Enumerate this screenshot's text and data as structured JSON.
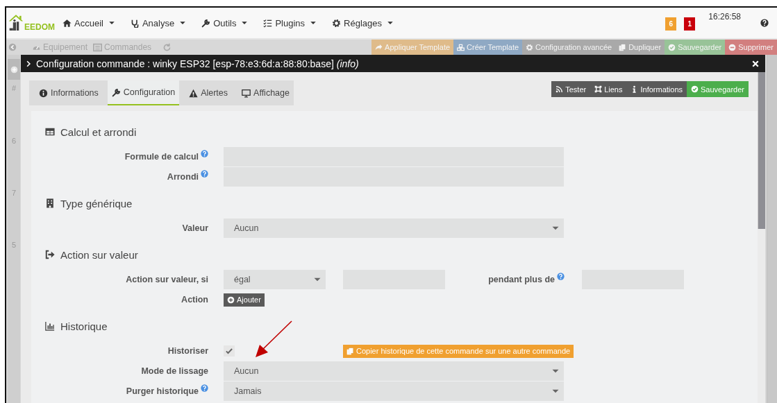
{
  "nav": {
    "logo": "EEDOM",
    "menus": [
      {
        "label": "Accueil"
      },
      {
        "label": "Analyse"
      },
      {
        "label": "Outils"
      },
      {
        "label": "Plugins"
      },
      {
        "label": "Réglages"
      }
    ],
    "badges": [
      {
        "text": "6",
        "color": "#f0a030"
      },
      {
        "text": "1",
        "color": "#c9000b"
      }
    ],
    "time": "16:26:58"
  },
  "page": {
    "tabs": [
      {
        "label": "Equipement"
      },
      {
        "label": "Commandes"
      }
    ],
    "actions": [
      {
        "label": "Appliquer Template",
        "color": "#dfbb8a"
      },
      {
        "label": "Créer Template",
        "color": "#8fa9c4"
      },
      {
        "label": "Configuration avancée",
        "color": "#a9a9a9"
      },
      {
        "label": "Dupliquer",
        "color": "#a9a9a9"
      },
      {
        "label": "Sauvegarder",
        "color": "#98c398"
      },
      {
        "label": "Supprimer",
        "color": "#d27f7f"
      }
    ],
    "row_numbers": [
      "#",
      "6",
      "7",
      "5"
    ]
  },
  "modal": {
    "title": "Configuration commande : winky ESP32 [esp-78:e3:6d:a:88:80:base] *(info)*",
    "tabs": [
      {
        "label": "Informations",
        "selected": false
      },
      {
        "label": "Configuration",
        "selected": true
      },
      {
        "label": "Alertes",
        "selected": false
      },
      {
        "label": "Affichage",
        "selected": false
      }
    ],
    "actions": [
      {
        "label": "Tester",
        "kind": "dark"
      },
      {
        "label": "Liens",
        "kind": "dark"
      },
      {
        "label": "Informations",
        "kind": "dark"
      },
      {
        "label": "Sauvegarder",
        "kind": "success"
      }
    ],
    "sections": [
      {
        "title": "Calcul et arrondi",
        "rows": [
          {
            "label": "Formule de calcul",
            "help": true,
            "fields": [
              {
                "kind": "input"
              }
            ]
          },
          {
            "label": "Arrondi",
            "help": true,
            "fields": [
              {
                "kind": "input"
              }
            ]
          }
        ]
      },
      {
        "title": "Type générique",
        "rows": [
          {
            "label": "Valeur",
            "help": false,
            "fields": [
              {
                "kind": "select",
                "value": "Aucun"
              }
            ]
          }
        ]
      },
      {
        "title": "Action sur valeur",
        "rows": [
          {
            "label": "Action sur valeur, si",
            "help": false,
            "fields": [
              {
                "kind": "select",
                "value": "égal"
              },
              {
                "kind": "input"
              },
              {
                "kind": "label",
                "label": "pendant plus de",
                "help": true
              },
              {
                "kind": "input"
              }
            ]
          },
          {
            "label": "Action",
            "help": false,
            "fields": [
              {
                "kind": "add-button",
                "label": "Ajouter"
              }
            ]
          }
        ]
      },
      {
        "title": "Historique",
        "rows": [
          {
            "label": "Historiser",
            "help": false,
            "fields": [
              {
                "kind": "checkbox",
                "checked": true
              },
              {
                "kind": "copy-button",
                "label": "Copier historique de cette commande sur une autre commande"
              }
            ]
          },
          {
            "label": "Mode de lissage",
            "help": false,
            "fields": [
              {
                "kind": "select",
                "value": "Aucun"
              }
            ]
          },
          {
            "label": "Purger historique",
            "help": true,
            "fields": [
              {
                "kind": "select",
                "value": "Jamais"
              }
            ]
          }
        ]
      }
    ]
  }
}
